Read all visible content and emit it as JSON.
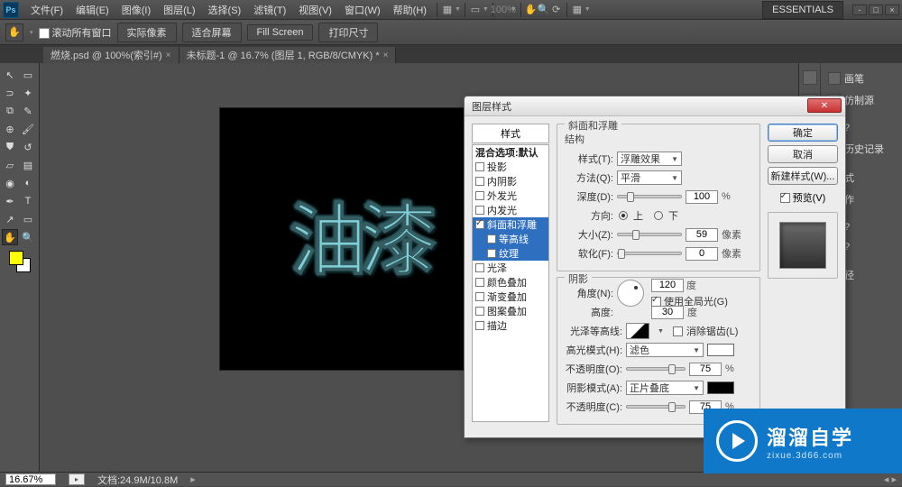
{
  "menu": {
    "items": [
      "文件(F)",
      "编辑(E)",
      "图像(I)",
      "图层(L)",
      "选择(S)",
      "滤镜(T)",
      "视图(V)",
      "窗口(W)",
      "帮助(H)"
    ],
    "essentials": "ESSENTIALS"
  },
  "optbar": {
    "scroll_all": "滚动所有窗口",
    "actual": "实际像素",
    "fit": "适合屏幕",
    "fill": "Fill Screen",
    "print": "打印尺寸",
    "zoom_pct": "100%"
  },
  "tabs": [
    {
      "label": "燃烧.psd @ 100%(索引#)"
    },
    {
      "label": "未标题-1 @ 16.7% (图层 1, RGB/8/CMYK) *"
    }
  ],
  "canvas": {
    "text": "油漆"
  },
  "right_panels": [
    "画笔",
    "仿制源",
    "?",
    "历史记录",
    "式",
    "作",
    "?",
    "?",
    "径"
  ],
  "status": {
    "zoom": "16.67%",
    "doc": "文档:24.9M/10.8M"
  },
  "dialog": {
    "title": "图层样式",
    "styles_header": "样式",
    "blend_header": "混合选项:默认",
    "styles": [
      {
        "label": "投影",
        "checked": false
      },
      {
        "label": "内阴影",
        "checked": false
      },
      {
        "label": "外发光",
        "checked": false
      },
      {
        "label": "内发光",
        "checked": false
      },
      {
        "label": "斜面和浮雕",
        "checked": true,
        "selected": true
      },
      {
        "label": "等高线",
        "checked": false,
        "sub": true,
        "selected": true
      },
      {
        "label": "纹理",
        "checked": false,
        "sub": true,
        "selected": true
      },
      {
        "label": "光泽",
        "checked": false
      },
      {
        "label": "颜色叠加",
        "checked": false
      },
      {
        "label": "渐变叠加",
        "checked": false
      },
      {
        "label": "图案叠加",
        "checked": false
      },
      {
        "label": "描边",
        "checked": false
      }
    ],
    "bevel": {
      "section": "斜面和浮雕",
      "structure": "结构",
      "style_lbl": "样式(T):",
      "style_val": "浮雕效果",
      "tech_lbl": "方法(Q):",
      "tech_val": "平滑",
      "depth_lbl": "深度(D):",
      "depth_val": 100,
      "depth_unit": "%",
      "dir_lbl": "方向:",
      "dir_up": "上",
      "dir_down": "下",
      "size_lbl": "大小(Z):",
      "size_val": 59,
      "size_unit": "像素",
      "soften_lbl": "软化(F):",
      "soften_val": 0,
      "soften_unit": "像素"
    },
    "shade": {
      "section": "阴影",
      "angle_lbl": "角度(N):",
      "angle_val": 120,
      "angle_unit": "度",
      "global": "使用全局光(G)",
      "alt_lbl": "高度:",
      "alt_val": 30,
      "alt_unit": "度",
      "gloss_lbl": "光泽等高线:",
      "aa": "消除锯齿(L)",
      "hl_mode_lbl": "高光模式(H):",
      "hl_mode_val": "滤色",
      "hl_op_lbl": "不透明度(O):",
      "hl_op_val": 75,
      "hl_op_unit": "%",
      "sh_mode_lbl": "阴影模式(A):",
      "sh_mode_val": "正片叠底",
      "sh_op_lbl": "不透明度(C):",
      "sh_op_val": 75,
      "sh_op_unit": "%"
    },
    "buttons": {
      "ok": "确定",
      "cancel": "取消",
      "new": "新建样式(W)...",
      "preview": "预览(V)"
    }
  },
  "wm": {
    "brand": "溜溜自学",
    "url": "zixue.3d66.com"
  }
}
